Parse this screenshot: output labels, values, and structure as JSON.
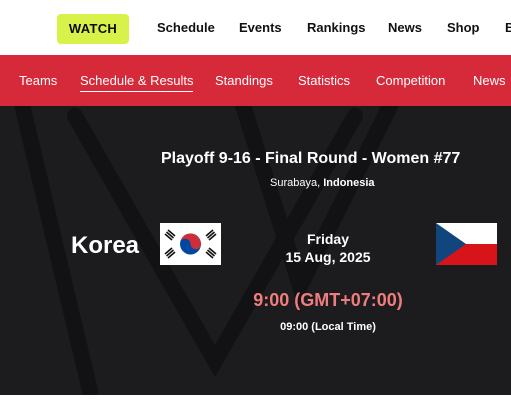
{
  "top_nav": {
    "watch_label": "WATCH",
    "items": [
      "Schedule",
      "Events",
      "Rankings",
      "News",
      "Shop",
      "B"
    ]
  },
  "sub_nav": {
    "items": [
      "Teams",
      "Schedule & Results",
      "Standings",
      "Statistics",
      "Competition",
      "News"
    ],
    "active": "Schedule & Results"
  },
  "match": {
    "title": "Playoff 9-16 - Final Round - Women #77",
    "city": "Surabaya, ",
    "country": "Indonesia",
    "home_team": "Korea",
    "home_flag": "south-korea-flag-icon",
    "away_flag": "czech-republic-flag-icon",
    "day": "Friday",
    "date": "15 Aug, 2025",
    "time_gmt": "9:00 (GMT+07:00)",
    "time_local": "09:00 (Local Time)"
  },
  "colors": {
    "watch_accent": "#d9f24a",
    "sub_nav_bg": "#d62a3a",
    "hero_bg": "#1c1b1d",
    "time_accent": "#f07d7d"
  }
}
